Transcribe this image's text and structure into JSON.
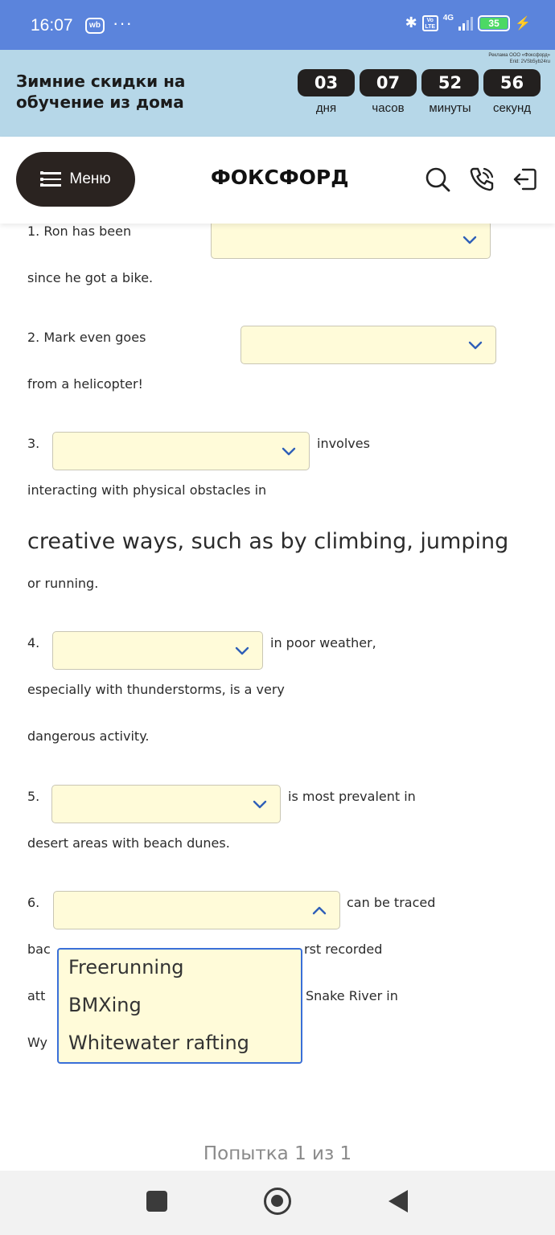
{
  "status_bar": {
    "time": "16:07",
    "app_badge": "wb",
    "more": "···",
    "volte": "Vo LTE",
    "network": "4G",
    "battery": "35",
    "icons": [
      "bluetooth-icon",
      "volte-icon",
      "signal-icon",
      "battery-icon",
      "charging-icon"
    ]
  },
  "promo": {
    "ad_line1": "Реклама ООО «Фоксфорд»",
    "ad_line2": "Erid: 2VSb5yb24ru",
    "title": "Зимние скидки на обучение из дома",
    "countdown": [
      {
        "value": "03",
        "label": "дня"
      },
      {
        "value": "07",
        "label": "часов"
      },
      {
        "value": "52",
        "label": "минуты"
      },
      {
        "value": "56",
        "label": "секунд"
      }
    ]
  },
  "header": {
    "menu_label": "Меню",
    "logo": "ФОКСФОРД",
    "icons": [
      "search-icon",
      "phone-icon",
      "login-icon"
    ]
  },
  "quiz": {
    "lines": [
      {
        "id": "q1a",
        "text": "1. Ron has been"
      },
      {
        "id": "q1b",
        "text": "since he got a bike."
      },
      {
        "id": "q2a",
        "text": "2. Mark even goes"
      },
      {
        "id": "q2b",
        "text": "from a helicopter!"
      },
      {
        "id": "q3a",
        "text": "3."
      },
      {
        "id": "q3b",
        "text": "involves"
      },
      {
        "id": "q3c",
        "text": "interacting with physical obstacles in"
      },
      {
        "id": "q3d",
        "text": "creative ways, such as by climbing, jumping"
      },
      {
        "id": "q3e",
        "text": "or running."
      },
      {
        "id": "q4a",
        "text": "4."
      },
      {
        "id": "q4b",
        "text": "in poor weather,"
      },
      {
        "id": "q4c",
        "text": "especially with thunderstorms, is a very"
      },
      {
        "id": "q4d",
        "text": "dangerous activity."
      },
      {
        "id": "q5a",
        "text": "5."
      },
      {
        "id": "q5b",
        "text": "is most prevalent in"
      },
      {
        "id": "q5c",
        "text": "desert areas with beach dunes."
      },
      {
        "id": "q6a",
        "text": "6."
      },
      {
        "id": "q6b",
        "text": "can be traced"
      },
      {
        "id": "q6c",
        "text": "bac"
      },
      {
        "id": "q6d",
        "text": "rst recorded"
      },
      {
        "id": "q6e",
        "text": "att"
      },
      {
        "id": "q6f",
        "text": "Snake River in"
      },
      {
        "id": "q6g",
        "text": "Wy"
      }
    ],
    "selects": [
      {
        "id": "select-1",
        "value": "",
        "state": "collapsed"
      },
      {
        "id": "select-2",
        "value": "",
        "state": "collapsed"
      },
      {
        "id": "select-3",
        "value": "",
        "state": "collapsed"
      },
      {
        "id": "select-4",
        "value": "",
        "state": "collapsed"
      },
      {
        "id": "select-5",
        "value": "",
        "state": "collapsed"
      },
      {
        "id": "select-6",
        "value": "",
        "state": "expanded"
      }
    ],
    "dropdown_options": [
      "Freerunning",
      "BMXing",
      "Whitewater rafting"
    ],
    "attempt": "Попытка 1 из 1"
  },
  "colors": {
    "status_bar": "#5b84dc",
    "promo_bg": "#b6d7e8",
    "select_bg": "#fffbd9",
    "dropdown_border": "#3a6fd8",
    "menu_button": "#2a2320"
  }
}
